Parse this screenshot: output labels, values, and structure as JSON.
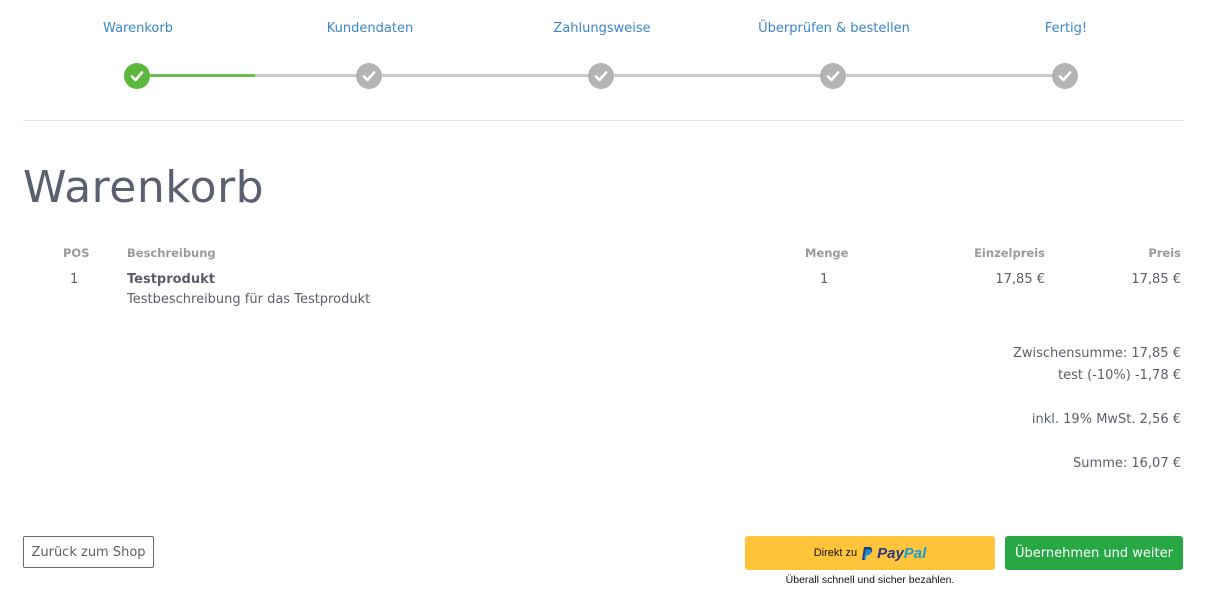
{
  "steps": [
    {
      "label": "Warenkorb",
      "status": "done"
    },
    {
      "label": "Kundendaten",
      "status": "pending"
    },
    {
      "label": "Zahlungsweise",
      "status": "pending"
    },
    {
      "label": "Überprüfen & bestellen",
      "status": "pending"
    },
    {
      "label": "Fertig!",
      "status": "pending"
    }
  ],
  "page_title": "Warenkorb",
  "table": {
    "headers": {
      "pos": "POS",
      "description": "Beschreibung",
      "qty": "Menge",
      "unit_price": "Einzelpreis",
      "price": "Preis"
    },
    "rows": [
      {
        "pos": "1",
        "name": "Testprodukt",
        "description": "Testbeschreibung für das Testprodukt",
        "qty": "1",
        "unit_price": "17,85 €",
        "price": "17,85 €"
      }
    ]
  },
  "totals": {
    "subtotal": "Zwischensumme: 17,85 €",
    "discount": "test (-10%) -1,78 €",
    "tax": "inkl. 19% MwSt.  2,56 €",
    "sum": "Summe: 16,07 €"
  },
  "buttons": {
    "back": "Zurück zum Shop",
    "paypal_prefix": "Direkt zu",
    "paypal_brand_pay": "Pay",
    "paypal_brand_pal": "Pal",
    "paypal_tagline": "Überall schnell und sicher bezahlen.",
    "next": "Übernehmen und weiter"
  },
  "colors": {
    "accent": "#3a86c8",
    "done": "#5cb83c",
    "pending": "#b4b4b4",
    "primary_button": "#28a745",
    "paypal_button": "#ffc439"
  }
}
